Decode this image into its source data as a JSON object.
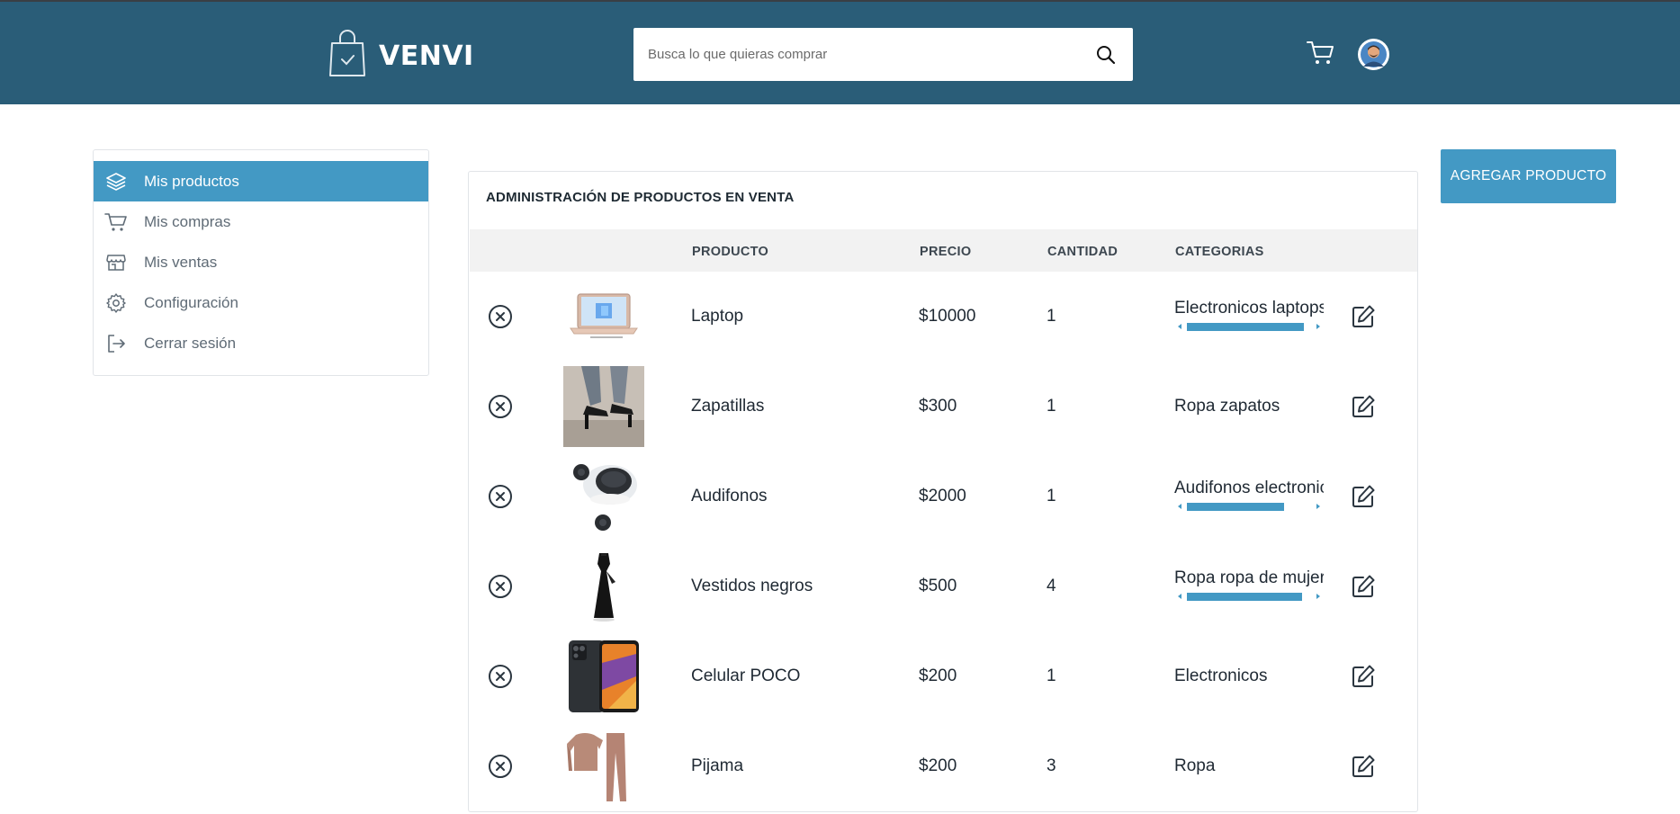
{
  "brand": {
    "name": "VENVI"
  },
  "search": {
    "placeholder": "Busca lo que quieras comprar"
  },
  "sidebar": {
    "items": [
      {
        "label": "Mis productos",
        "icon": "layers-icon",
        "active": true
      },
      {
        "label": "Mis compras",
        "icon": "cart-icon",
        "active": false
      },
      {
        "label": "Mis ventas",
        "icon": "store-icon",
        "active": false
      },
      {
        "label": "Configuración",
        "icon": "gear-icon",
        "active": false
      },
      {
        "label": "Cerrar sesión",
        "icon": "logout-icon",
        "active": false
      }
    ]
  },
  "add_button": {
    "label": "AGREGAR PRODUCTO"
  },
  "panel": {
    "title": "ADMINISTRACIÓN DE PRODUCTOS EN VENTA",
    "columns": {
      "producto": "PRODUCTO",
      "precio": "PRECIO",
      "cantidad": "CANTIDAD",
      "categorias": "CATEGORIAS"
    },
    "rows": [
      {
        "name": "Laptop",
        "price": "$10000",
        "qty": "1",
        "categories": "Electronicos laptops",
        "image": "laptop-image"
      },
      {
        "name": "Zapatillas",
        "price": "$300",
        "qty": "1",
        "categories": "Ropa zapatos",
        "image": "heels-image"
      },
      {
        "name": "Audifonos",
        "price": "$2000",
        "qty": "1",
        "categories": "Audifonos electronicos",
        "image": "earbuds-image"
      },
      {
        "name": "Vestidos negros",
        "price": "$500",
        "qty": "4",
        "categories": "Ropa ropa de mujer",
        "image": "dress-image"
      },
      {
        "name": "Celular POCO",
        "price": "$200",
        "qty": "1",
        "categories": "Electronicos",
        "image": "phone-image"
      },
      {
        "name": "Pijama",
        "price": "$200",
        "qty": "3",
        "categories": "Ropa",
        "image": "pajama-image"
      }
    ]
  },
  "colors": {
    "header": "#2a5d78",
    "accent": "#4399c4"
  }
}
